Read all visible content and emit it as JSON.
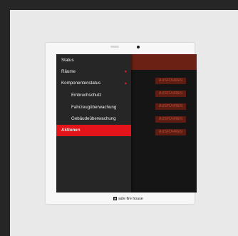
{
  "sidebar": {
    "items": [
      {
        "label": "Status",
        "level": 0,
        "active": false,
        "chevron": ""
      },
      {
        "label": "Räume",
        "level": 0,
        "active": false,
        "chevron": "chevron-down"
      },
      {
        "label": "Komponentenstatus",
        "level": 0,
        "active": false,
        "chevron": "chevron-up"
      },
      {
        "label": "Einbruchschutz",
        "level": 1,
        "active": false,
        "chevron": ""
      },
      {
        "label": "Fahrzeugüberwachung",
        "level": 1,
        "active": false,
        "chevron": ""
      },
      {
        "label": "Gebäudeüberwachung",
        "level": 1,
        "active": false,
        "chevron": ""
      },
      {
        "label": "Aktionen",
        "level": 0,
        "active": true,
        "chevron": ""
      }
    ]
  },
  "actions": {
    "buttons": [
      "AUSFÜHREN",
      "AUSFÜHREN",
      "AUSFÜHREN",
      "AUSFÜHREN",
      "AUSFÜHREN"
    ]
  },
  "brand": {
    "name": "safe fire house"
  },
  "colors": {
    "accent": "#e4141b",
    "header": "#6b2114",
    "button_bg": "#5e1d12",
    "button_text": "#c24a34",
    "sidebar_bg": "#262626",
    "content_bg": "#151515"
  }
}
